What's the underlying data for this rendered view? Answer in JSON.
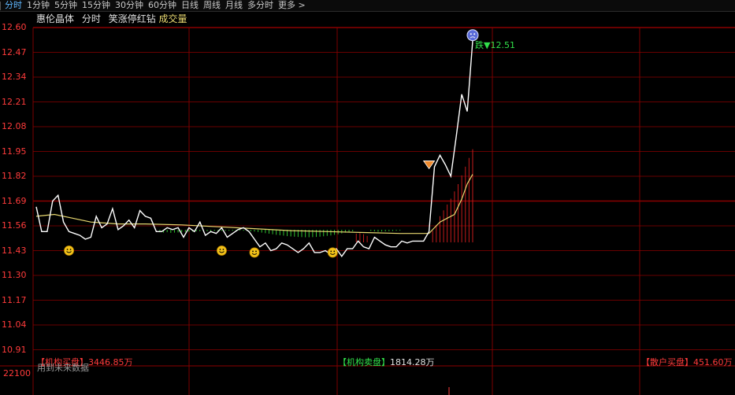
{
  "tabs": [
    {
      "label": "分时",
      "active": true
    },
    {
      "label": "1分钟",
      "active": false
    },
    {
      "label": "5分钟",
      "active": false
    },
    {
      "label": "15分钟",
      "active": false
    },
    {
      "label": "30分钟",
      "active": false
    },
    {
      "label": "60分钟",
      "active": false
    },
    {
      "label": "日线",
      "active": false
    },
    {
      "label": "周线",
      "active": false
    },
    {
      "label": "月线",
      "active": false
    },
    {
      "label": "多分时",
      "active": false
    },
    {
      "label": "更多 >",
      "active": false
    }
  ],
  "title": {
    "stock_name": "惠伦晶体",
    "chart_mode": "分时",
    "indicator": "笑涨停红钻",
    "volume_label": "成交量"
  },
  "colors": {
    "price_line": "#ffffff",
    "avg_line": "#e8d870",
    "grid": "#8b0000",
    "axis_text": "#ff3b3b",
    "up_bar": "#c31b1b",
    "down_bar": "#2fc02f",
    "buy": "#ff3b3b",
    "sell": "#31e04a"
  },
  "chart_data": {
    "type": "line",
    "y_ticks": [
      "12.60",
      "12.47",
      "12.34",
      "12.21",
      "12.08",
      "11.95",
      "11.82",
      "11.69",
      "11.56",
      "11.43",
      "11.30",
      "11.17",
      "11.04",
      "10.91"
    ],
    "ylim": [
      10.91,
      12.6
    ],
    "xlim": [
      0,
      240
    ],
    "series": [
      {
        "values": [
          [
            0,
            11.66
          ],
          [
            3,
            11.53
          ],
          [
            6,
            11.53
          ],
          [
            9,
            11.69
          ],
          [
            12,
            11.72
          ],
          [
            15,
            11.58
          ],
          [
            18,
            11.53
          ],
          [
            21,
            11.52
          ],
          [
            24,
            11.51
          ],
          [
            27,
            11.49
          ],
          [
            30,
            11.5
          ],
          [
            33,
            11.61
          ],
          [
            36,
            11.55
          ],
          [
            39,
            11.57
          ],
          [
            42,
            11.65
          ],
          [
            45,
            11.54
          ],
          [
            48,
            11.56
          ],
          [
            51,
            11.59
          ],
          [
            54,
            11.55
          ],
          [
            57,
            11.64
          ],
          [
            60,
            11.61
          ],
          [
            63,
            11.6
          ],
          [
            66,
            11.53
          ],
          [
            69,
            11.53
          ],
          [
            72,
            11.55
          ],
          [
            75,
            11.54
          ],
          [
            78,
            11.55
          ],
          [
            81,
            11.5
          ],
          [
            84,
            11.55
          ],
          [
            87,
            11.53
          ],
          [
            90,
            11.58
          ],
          [
            93,
            11.51
          ],
          [
            96,
            11.53
          ],
          [
            99,
            11.52
          ],
          [
            102,
            11.55
          ],
          [
            105,
            11.5
          ],
          [
            108,
            11.52
          ],
          [
            111,
            11.54
          ],
          [
            114,
            11.55
          ],
          [
            117,
            11.53
          ],
          [
            120,
            11.49
          ],
          [
            123,
            11.45
          ],
          [
            126,
            11.47
          ],
          [
            129,
            11.43
          ],
          [
            132,
            11.44
          ],
          [
            135,
            11.47
          ],
          [
            138,
            11.46
          ],
          [
            141,
            11.44
          ],
          [
            144,
            11.42
          ],
          [
            147,
            11.44
          ],
          [
            150,
            11.47
          ],
          [
            153,
            11.42
          ],
          [
            156,
            11.42
          ],
          [
            159,
            11.43
          ],
          [
            162,
            11.41
          ],
          [
            165,
            11.44
          ],
          [
            168,
            11.4
          ],
          [
            171,
            11.44
          ],
          [
            174,
            11.44
          ],
          [
            177,
            11.48
          ],
          [
            180,
            11.45
          ],
          [
            183,
            11.44
          ],
          [
            186,
            11.5
          ],
          [
            189,
            11.48
          ],
          [
            192,
            11.46
          ],
          [
            195,
            11.45
          ],
          [
            198,
            11.45
          ],
          [
            201,
            11.48
          ],
          [
            204,
            11.47
          ],
          [
            207,
            11.48
          ],
          [
            210,
            11.48
          ],
          [
            213,
            11.48
          ],
          [
            216,
            11.53
          ],
          [
            219,
            11.87
          ],
          [
            222,
            11.93
          ],
          [
            225,
            11.88
          ],
          [
            228,
            11.82
          ],
          [
            231,
            12.03
          ],
          [
            234,
            12.25
          ],
          [
            237,
            12.16
          ],
          [
            240,
            12.53
          ]
        ]
      },
      {
        "values": [
          [
            0,
            11.61
          ],
          [
            10,
            11.62
          ],
          [
            20,
            11.6
          ],
          [
            30,
            11.58
          ],
          [
            45,
            11.57
          ],
          [
            60,
            11.57
          ],
          [
            80,
            11.565
          ],
          [
            100,
            11.555
          ],
          [
            120,
            11.545
          ],
          [
            140,
            11.535
          ],
          [
            160,
            11.53
          ],
          [
            180,
            11.525
          ],
          [
            200,
            11.52
          ],
          [
            216,
            11.52
          ],
          [
            219,
            11.55
          ],
          [
            222,
            11.58
          ],
          [
            226,
            11.6
          ],
          [
            230,
            11.62
          ],
          [
            234,
            11.7
          ],
          [
            237,
            11.78
          ],
          [
            240,
            11.83
          ]
        ]
      }
    ],
    "volume": {
      "label": "22100",
      "bars": [
        [
          68,
          -0.3
        ],
        [
          70,
          -0.35
        ],
        [
          72,
          -0.3
        ],
        [
          74,
          -0.38
        ],
        [
          76,
          -0.35
        ],
        [
          78,
          -0.33
        ],
        [
          80,
          -0.3
        ],
        [
          82,
          -0.28
        ],
        [
          84,
          -0.25
        ],
        [
          86,
          -0.22
        ],
        [
          88,
          -0.2
        ],
        [
          90,
          -0.18
        ],
        [
          92,
          -0.17
        ],
        [
          94,
          -0.16
        ],
        [
          96,
          -0.15
        ],
        [
          98,
          -0.14
        ],
        [
          100,
          -0.13
        ],
        [
          102,
          -0.13
        ],
        [
          104,
          -0.12
        ],
        [
          106,
          -0.12
        ],
        [
          108,
          -0.12
        ],
        [
          110,
          -0.11
        ],
        [
          112,
          -0.1
        ],
        [
          114,
          -0.12
        ],
        [
          116,
          -0.15
        ],
        [
          118,
          -0.18
        ],
        [
          120,
          -0.22
        ],
        [
          122,
          -0.28
        ],
        [
          124,
          -0.35
        ],
        [
          126,
          -0.42
        ],
        [
          128,
          -0.48
        ],
        [
          130,
          -0.55
        ],
        [
          132,
          -0.62
        ],
        [
          134,
          -0.68
        ],
        [
          136,
          -0.72
        ],
        [
          138,
          -0.78
        ],
        [
          140,
          -0.82
        ],
        [
          142,
          -0.85
        ],
        [
          144,
          -0.88
        ],
        [
          146,
          -0.9
        ],
        [
          148,
          -0.92
        ],
        [
          150,
          -0.92
        ],
        [
          152,
          -0.9
        ],
        [
          154,
          -0.88
        ],
        [
          156,
          -0.85
        ],
        [
          158,
          -0.8
        ],
        [
          160,
          -0.75
        ],
        [
          162,
          -0.7
        ],
        [
          164,
          -0.62
        ],
        [
          166,
          -0.55
        ],
        [
          168,
          -0.45
        ],
        [
          170,
          -0.35
        ],
        [
          172,
          -0.25
        ],
        [
          174,
          -0.18
        ],
        [
          176,
          0.3
        ],
        [
          178,
          0.32
        ],
        [
          180,
          0.28
        ],
        [
          182,
          0.22
        ],
        [
          184,
          -0.15
        ],
        [
          186,
          -0.2
        ],
        [
          188,
          -0.25
        ],
        [
          190,
          -0.22
        ],
        [
          192,
          -0.2
        ],
        [
          194,
          -0.18
        ],
        [
          196,
          -0.15
        ],
        [
          198,
          -0.12
        ],
        [
          200,
          -0.1
        ],
        [
          218,
          0.4
        ],
        [
          220,
          0.6
        ],
        [
          222,
          0.9
        ],
        [
          224,
          1.1
        ],
        [
          226,
          1.3
        ],
        [
          228,
          1.5
        ],
        [
          230,
          1.75
        ],
        [
          232,
          2.0
        ],
        [
          234,
          2.3
        ],
        [
          236,
          2.6
        ],
        [
          238,
          2.9
        ],
        [
          240,
          3.2
        ]
      ]
    },
    "markers": [
      {
        "type": "smile",
        "x": 18,
        "y": 11.43
      },
      {
        "type": "smile",
        "x": 102,
        "y": 11.43
      },
      {
        "type": "smile",
        "x": 120,
        "y": 11.42
      },
      {
        "type": "smile",
        "x": 163,
        "y": 11.42
      },
      {
        "type": "warning",
        "x": 216,
        "y": 11.88
      },
      {
        "type": "sad",
        "x": 240,
        "y": 12.56
      }
    ],
    "annotation": {
      "text": "跌▼12.51",
      "x": 240,
      "y": 12.51
    }
  },
  "flows": {
    "inst_buy": {
      "label": "【机构买盘】",
      "value": "3446.85万"
    },
    "inst_sell": {
      "label": "【机构卖盘】",
      "value": "1814.28万"
    },
    "retail_buy": {
      "label": "【散户买盘】",
      "value": "451.60万"
    },
    "future_note": "用到未来数据"
  }
}
